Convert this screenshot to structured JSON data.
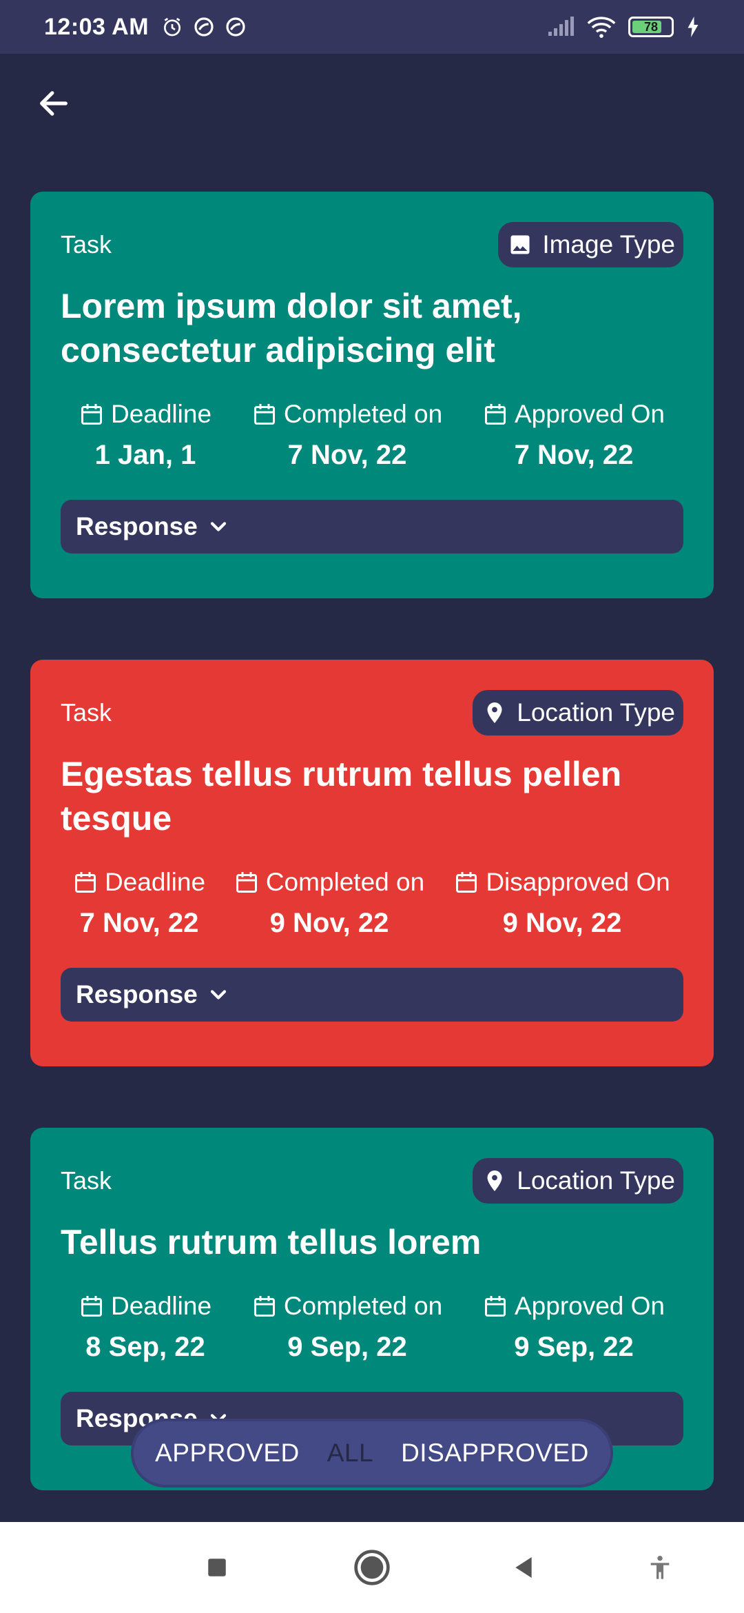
{
  "status_bar": {
    "time": "12:03 AM",
    "battery_level": "78",
    "battery_fraction": 0.78,
    "icons_left": [
      "alarm-icon",
      "do-not-disturb-icon",
      "do-not-disturb-icon"
    ],
    "icons_right": [
      "signal-icon",
      "wifi-icon",
      "battery-icon",
      "charging-icon"
    ]
  },
  "colors": {
    "background": "#262946",
    "approved_card": "#00897b",
    "disapproved_card": "#e53935",
    "chip": "#35365e"
  },
  "tasks": [
    {
      "label": "Task",
      "type": "Image Type",
      "type_icon": "image-icon",
      "title": "Lorem ipsum dolor sit amet, consectetur adipiscing elit",
      "status": "approved",
      "dates": [
        {
          "label": "Deadline",
          "value": "1 Jan, 1"
        },
        {
          "label": "Completed on",
          "value": "7 Nov, 22"
        },
        {
          "label": "Approved On",
          "value": "7 Nov, 22"
        }
      ],
      "response_label": "Response"
    },
    {
      "label": "Task",
      "type": "Location Type",
      "type_icon": "location-pin-icon",
      "title": "Egestas tellus rutrum tellus pellen tesque",
      "status": "disapproved",
      "dates": [
        {
          "label": "Deadline",
          "value": "7 Nov, 22"
        },
        {
          "label": "Completed on",
          "value": "9 Nov, 22"
        },
        {
          "label": "Disapproved On",
          "value": "9 Nov, 22"
        }
      ],
      "response_label": "Response"
    },
    {
      "label": "Task",
      "type": "Location Type",
      "type_icon": "location-pin-icon",
      "title": "Tellus rutrum tellus lorem",
      "status": "approved",
      "dates": [
        {
          "label": "Deadline",
          "value": "8 Sep, 22"
        },
        {
          "label": "Completed on",
          "value": "9 Sep, 22"
        },
        {
          "label": "Approved On",
          "value": "9 Sep, 22"
        }
      ],
      "response_label": "Response"
    }
  ],
  "filter": {
    "options": [
      "APPROVED",
      "ALL",
      "DISAPPROVED"
    ],
    "selected": "ALL"
  },
  "nav_bar": {
    "icons": [
      "recents-square-icon",
      "home-circle-icon",
      "back-triangle-icon",
      "accessibility-icon"
    ]
  }
}
